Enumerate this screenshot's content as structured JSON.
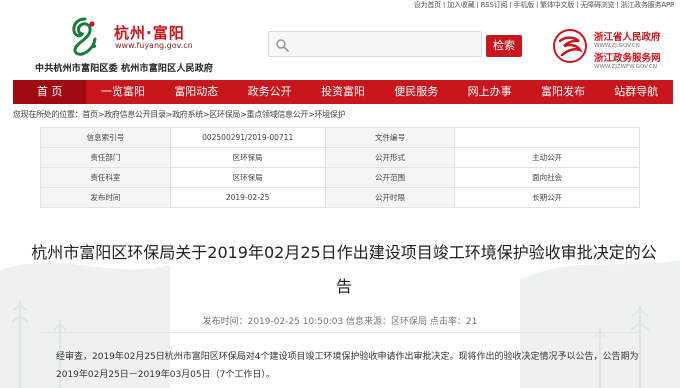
{
  "toplinks": "设为首页 | 加入收藏 | RSS订阅 | 手机版 | 繁体中文版 | 无障碍浏览 | 浙江政务服务APP",
  "header": {
    "site_name": "杭州·富阳",
    "site_url": "www.fuyang.gov.cn",
    "site_sub": "中共杭州市富阳区委   杭州市富阳区人民政府",
    "logo_text": "富阳",
    "search_button": "检索",
    "gov_name": "浙江省人民政府",
    "gov_url": "WWW.ZJ.GOV.CN",
    "gov_service": "浙江政务服务网",
    "gov_service_url": "WWW.ZJZWFW.GOV.CN"
  },
  "nav": [
    "首 页",
    "一览富阳",
    "富阳动态",
    "政务公开",
    "投资富阳",
    "便民服务",
    "网上办事",
    "富阳发布",
    "站群导航"
  ],
  "breadcrumb": "您现在所处的位置：首页>政府信息公开目录>政府系统>区环保局>重点领域信息公开>环境保护",
  "info": {
    "r1": {
      "l1": "信息索引号",
      "v1": "002500291/2019-00711",
      "l2": "文件编号",
      "v2": ""
    },
    "r2": {
      "l1": "责任部门",
      "v1": "区环保局",
      "l2": "公开形式",
      "v2": "主动公开"
    },
    "r3": {
      "l1": "责任科室",
      "v1": "区环保局",
      "l2": "公开范围",
      "v2": "面向社会"
    },
    "r4": {
      "l1": "发布时间",
      "v1": "2019-02-25",
      "l2": "公开时限",
      "v2": "长期公开"
    }
  },
  "article": {
    "title": "杭州市富阳区环保局关于2019年02月25日作出建设项目竣工环境保护验收审批决定的公告",
    "meta": "发布时间：2019-02-25 10:50:03   信息来源：区环保局   点击率：21",
    "body": "经审查，2019年02月25日杭州市富阳区环保局对4个建设项目竣工环境保护验收申请作出审批决定。现将作出的验收决定情况予以公告，公告期为2019年02月25日－2019年03月05日（7个工作日）。"
  }
}
